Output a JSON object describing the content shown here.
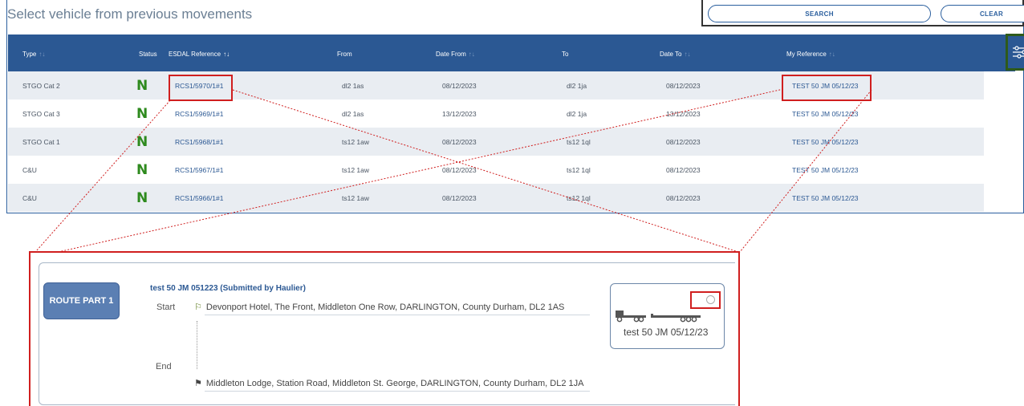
{
  "page": {
    "title": "Select vehicle from previous movements"
  },
  "search": {
    "search_label": "SEARCH",
    "clear_label": "CLEAR"
  },
  "table": {
    "headers": {
      "type": "Type",
      "status": "Status",
      "esdal_reference": "ESDAL Reference",
      "from": "From",
      "date_from": "Date From",
      "to": "To",
      "date_to": "Date To",
      "my_reference": "My Reference"
    },
    "sort_glyph": "↑↓",
    "rows": [
      {
        "type": "STGO Cat 2",
        "status": "N",
        "esdal": "RCS1/5970/1#1",
        "from": "dl2 1as",
        "date_from": "08/12/2023",
        "to": "dl2 1ja",
        "date_to": "08/12/2023",
        "my_ref": "TEST 50 JM 05/12/23"
      },
      {
        "type": "STGO Cat 3",
        "status": "N",
        "esdal": "RCS1/5969/1#1",
        "from": "dl2 1as",
        "date_from": "13/12/2023",
        "to": "dl2 1ja",
        "date_to": "13/12/2023",
        "my_ref": "TEST 50 JM 05/12/23"
      },
      {
        "type": "STGO Cat 1",
        "status": "N",
        "esdal": "RCS1/5968/1#1",
        "from": "ts12 1aw",
        "date_from": "08/12/2023",
        "to": "ts12 1ql",
        "date_to": "08/12/2023",
        "my_ref": "TEST 50 JM 05/12/23"
      },
      {
        "type": "C&U",
        "status": "N",
        "esdal": "RCS1/5967/1#1",
        "from": "ts12 1aw",
        "date_from": "08/12/2023",
        "to": "ts12 1ql",
        "date_to": "08/12/2023",
        "my_ref": "TEST 50 JM 05/12/23"
      },
      {
        "type": "C&U",
        "status": "N",
        "esdal": "RCS1/5966/1#1",
        "from": "ts12 1aw",
        "date_from": "08/12/2023",
        "to": "ts12 1ql",
        "date_to": "08/12/2023",
        "my_ref": "TEST 50 JM 05/12/23"
      }
    ]
  },
  "route": {
    "badge": "ROUTE PART 1",
    "title": "test 50 JM 051223 (Submitted by Haulier)",
    "start_label": "Start",
    "start_address": "Devonport Hotel, The Front, Middleton One Row, DARLINGTON, County Durham, DL2 1AS",
    "end_label": "End",
    "end_address": "Middleton Lodge, Station Road, Middleton St. George, DARLINGTON, County Durham, DL2 1JA",
    "vehicle_name": "test 50 JM 05/12/23"
  },
  "colors": {
    "header_bg": "#2b5893",
    "link": "#2b5893",
    "status_n": "#2e8a1e",
    "highlight": "#d01f1f"
  },
  "icons": {
    "filter": "sliders-icon",
    "start": "start-flag-icon",
    "end": "finish-flag-icon",
    "vehicle": "truck-trailer-icon"
  }
}
